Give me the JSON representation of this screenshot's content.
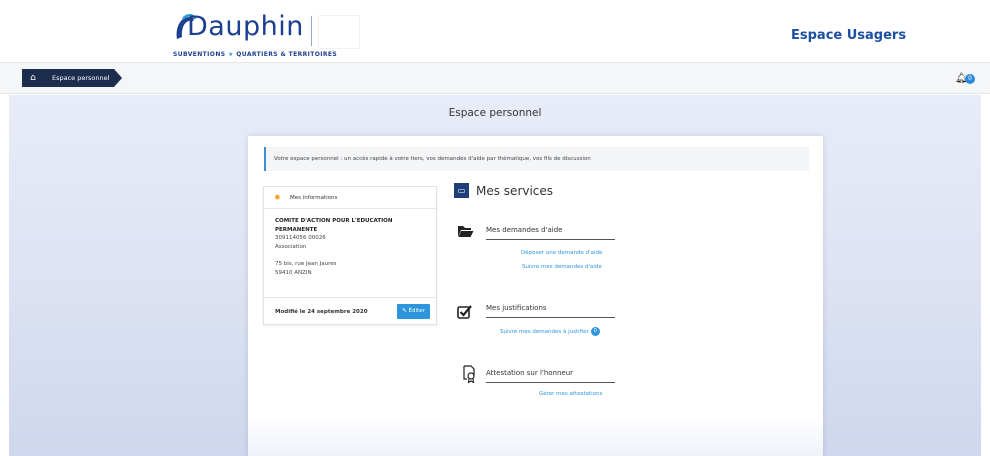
{
  "header": {
    "logo_word": "Dauphin",
    "logo_tagline_left": "SUBVENTIONS",
    "logo_tagline_star": "★",
    "logo_tagline_right": "QUARTIERS & TERRITOIRES",
    "portal_title": "Espace Usagers"
  },
  "breadcrumb": {
    "home_icon": "home-icon",
    "current": "Espace personnel"
  },
  "notifications": {
    "icon": "bell-icon",
    "count": "0"
  },
  "page": {
    "title": "Espace personnel",
    "intro": "Votre espace personnel : un accès rapide à votre tiers, vos demandes d'aide par thématique, vos fils de discussion"
  },
  "info_panel": {
    "title": "Mes informations",
    "org_name": "COMITE D'ACTION POUR L'EDUCATION PERMANENTE",
    "siret": "309114056 00026",
    "type": "Association",
    "address_line1": "75 bis, rue Jean Jaures",
    "address_line2": "59410 ANZIN",
    "modified": "Modifié le 24 septembre 2020",
    "edit_label": "✎ Éditer"
  },
  "services": {
    "title": "Mes services",
    "demandes": {
      "title": "Mes demandes d'aide",
      "link1": "Déposer une demande d'aide",
      "link2": "Suivre mes demandes d'aide"
    },
    "justifications": {
      "title": "Mes justifications",
      "link1": "Suivre mes demandes à justifier",
      "badge": "0"
    },
    "attestation": {
      "title": "Attestation sur l'honneur",
      "link1": "Gérer mes attestations"
    }
  },
  "colors": {
    "brand": "#1d3f8f",
    "link": "#2d95dc",
    "breadcrumb": "#1c2d4e"
  }
}
